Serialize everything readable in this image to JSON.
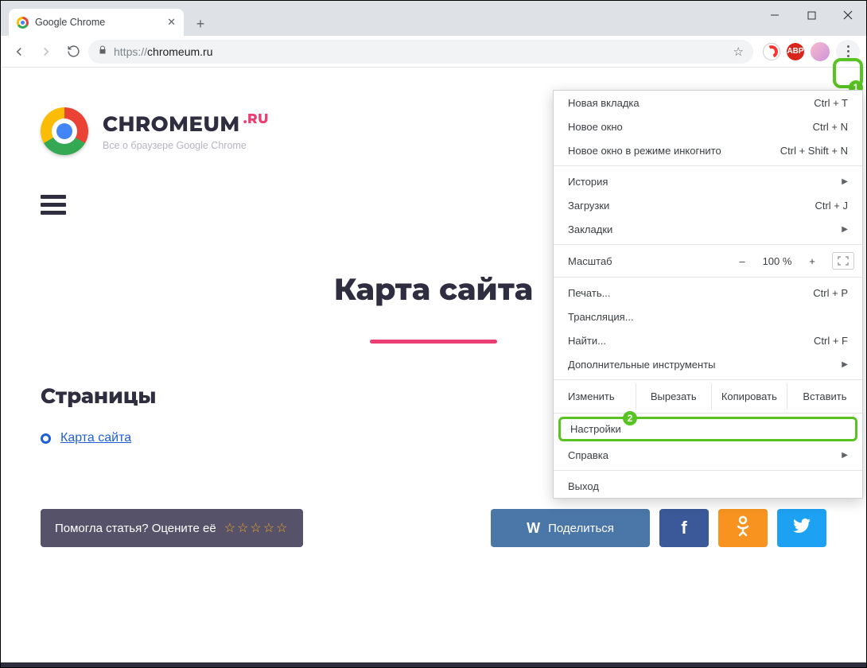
{
  "window": {
    "tab_title": "Google Chrome"
  },
  "toolbar": {
    "url_scheme": "https://",
    "url_host": "chromeum.ru",
    "ext_abp": "ABP"
  },
  "page": {
    "brand_name": "CHROMEUM",
    "brand_tld": ".RU",
    "brand_tagline": "Все о браузере Google Chrome",
    "title": "Карта сайта",
    "section_pages": "Страницы",
    "link_sitemap": "Карта сайта",
    "rate_prompt": "Помогла статья? Оцените её",
    "share_label": "Поделиться"
  },
  "menu": {
    "new_tab": "Новая вкладка",
    "new_tab_sc": "Ctrl + T",
    "new_window": "Новое окно",
    "new_window_sc": "Ctrl + N",
    "incognito": "Новое окно в режиме инкогнито",
    "incognito_sc": "Ctrl + Shift + N",
    "history": "История",
    "downloads": "Загрузки",
    "downloads_sc": "Ctrl + J",
    "bookmarks": "Закладки",
    "zoom": "Масштаб",
    "zoom_val": "100 %",
    "print": "Печать...",
    "print_sc": "Ctrl + P",
    "cast": "Трансляция...",
    "find": "Найти...",
    "find_sc": "Ctrl + F",
    "more_tools": "Дополнительные инструменты",
    "edit": "Изменить",
    "cut": "Вырезать",
    "copy": "Копировать",
    "paste": "Вставить",
    "settings": "Настройки",
    "help": "Справка",
    "exit": "Выход"
  },
  "annotations": {
    "badge1": "1",
    "badge2": "2"
  }
}
